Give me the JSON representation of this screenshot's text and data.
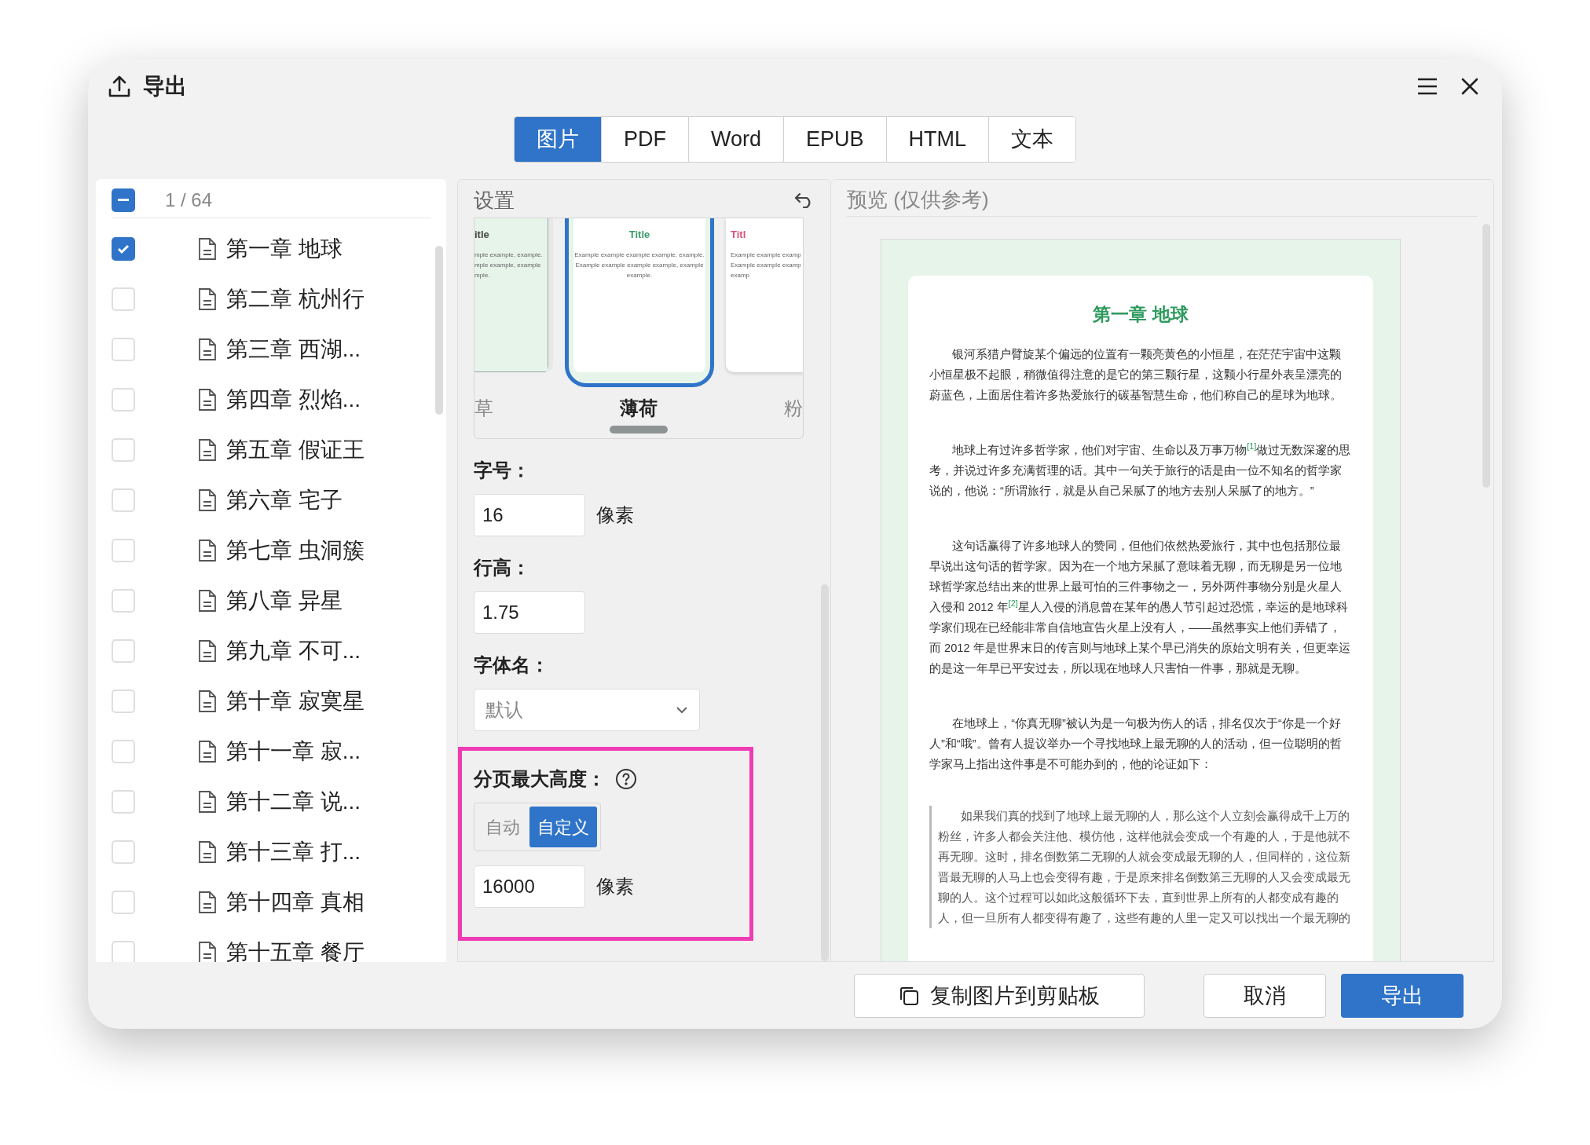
{
  "window": {
    "title": "导出"
  },
  "tabs": [
    {
      "label": "图片",
      "selected": true
    },
    {
      "label": "PDF",
      "selected": false
    },
    {
      "label": "Word",
      "selected": false
    },
    {
      "label": "EPUB",
      "selected": false
    },
    {
      "label": "HTML",
      "selected": false
    },
    {
      "label": "文本",
      "selected": false
    }
  ],
  "chapter_list": {
    "header_checkbox_mixed": true,
    "count": "1 / 64",
    "items": [
      {
        "title": "第一章 地球",
        "checked": true
      },
      {
        "title": "第二章 杭州行",
        "checked": false
      },
      {
        "title": "第三章 西湖...",
        "checked": false
      },
      {
        "title": "第四章 烈焰...",
        "checked": false
      },
      {
        "title": "第五章 假证王",
        "checked": false
      },
      {
        "title": "第六章 宅子",
        "checked": false
      },
      {
        "title": "第七章 虫洞簇",
        "checked": false
      },
      {
        "title": "第八章 异星",
        "checked": false
      },
      {
        "title": "第九章 不可...",
        "checked": false
      },
      {
        "title": "第十章 寂寞星",
        "checked": false
      },
      {
        "title": "第十一章 寂...",
        "checked": false
      },
      {
        "title": "第十二章 说...",
        "checked": false
      },
      {
        "title": "第十三章 打...",
        "checked": false
      },
      {
        "title": "第十四章 真相",
        "checked": false
      },
      {
        "title": "第十五章 餐厅",
        "checked": false
      }
    ]
  },
  "settings": {
    "title": "设置",
    "theme_cards": [
      {
        "kind": "left",
        "label": "草",
        "selected": false,
        "color": "#444444",
        "title": "itle",
        "lines": [
          "mple example, example.",
          "mple example, example",
          "mple."
        ]
      },
      {
        "kind": "center",
        "label": "薄荷",
        "selected": true,
        "color": "#3a9a6a",
        "title": "Title",
        "lines": [
          "Example example example example, example.",
          "Example example example example, example",
          "example."
        ]
      },
      {
        "kind": "right",
        "label": "粉",
        "selected": false,
        "color": "#d9507a",
        "title": "Titl",
        "lines": [
          "Example example examp",
          "Example example examp",
          "examp"
        ]
      }
    ],
    "font_size": {
      "label": "字号：",
      "value": "16",
      "unit": "像素"
    },
    "line_height": {
      "label": "行高：",
      "value": "1.75"
    },
    "font_name": {
      "label": "字体名：",
      "value": "默认"
    },
    "page_max_height": {
      "label": "分页最大高度：",
      "modes": [
        {
          "label": "自动",
          "selected": false
        },
        {
          "label": "自定义",
          "selected": true
        }
      ],
      "value": "16000",
      "unit": "像素"
    }
  },
  "preview": {
    "title": "预览 (仅供参考)",
    "heading": "第一章 地球",
    "paragraphs": [
      {
        "kind": "body",
        "text": "银河系猎户臂旋某个偏远的位置有一颗亮黄色的小恒星，在茫茫宇宙中这颗小恒星极不起眼，稍微值得注意的是它的第三颗行星，这颗小行星外表呈漂亮的蔚蓝色，上面居住着许多热爱旅行的碳基智慧生命，他们称自己的星球为地球。"
      },
      {
        "kind": "body",
        "text": "地球上有过许多哲学家，他们对宇宙、生命以及万事万物$^{[1]}$做过无数深邃的思考，并说过许多充满哲理的话。其中一句关于旅行的话是由一位不知名的哲学家说的，他说：“所谓旅行，就是从自己呆腻了的地方去别人呆腻了的地方。”"
      },
      {
        "kind": "body",
        "text": "这句话赢得了许多地球人的赞同，但他们依然热爱旅行，其中也包括那位最早说出这句话的哲学家。因为在一个地方呆腻了意味着无聊，而无聊是另一位地球哲学家总结出来的世界上最可怕的三件事物之一，另外两件事物分别是火星人入侵和 2012 年$^{[2]}$星人入侵的消息曾在某年的愚人节引起过恐慌，幸运的是地球科学家们现在已经能非常自信地宣告火星上没有人，——虽然事实上他们弄错了，而 2012 年是世界末日的传言则与地球上某个早已消失的原始文明有关，但更幸运的是这一年早已平安过去，所以现在地球人只害怕一件事，那就是无聊。"
      },
      {
        "kind": "body",
        "text": "在地球上，“你真无聊”被认为是一句极为伤人的话，排名仅次于“你是一个好人”和“哦”。曾有人提议举办一个寻找地球上最无聊的人的活动，但一位聪明的哲学家马上指出这件事是不可能办到的，他的论证如下："
      },
      {
        "kind": "quote",
        "text": "如果我们真的找到了地球上最无聊的人，那么这个人立刻会赢得成千上万的粉丝，许多人都会关注他、模仿他，这样他就会变成一个有趣的人，于是他就不再无聊。这时，排名倒数第二无聊的人就会变成最无聊的人，但同样的，这位新晋最无聊的人马上也会变得有趣，于是原来排名倒数第三无聊的人又会变成最无聊的人。这个过程可以如此这般循环下去，直到世界上所有的人都变成有趣的人，但一旦所有人都变得有趣了，这些有趣的人里一定又可以找出一个最无聊的"
      }
    ]
  },
  "buttons": [
    {
      "kind": "copy",
      "label": "复制图片到剪贴板"
    },
    {
      "kind": "secondary",
      "label": "取消"
    },
    {
      "kind": "primary",
      "label": "导出"
    }
  ]
}
